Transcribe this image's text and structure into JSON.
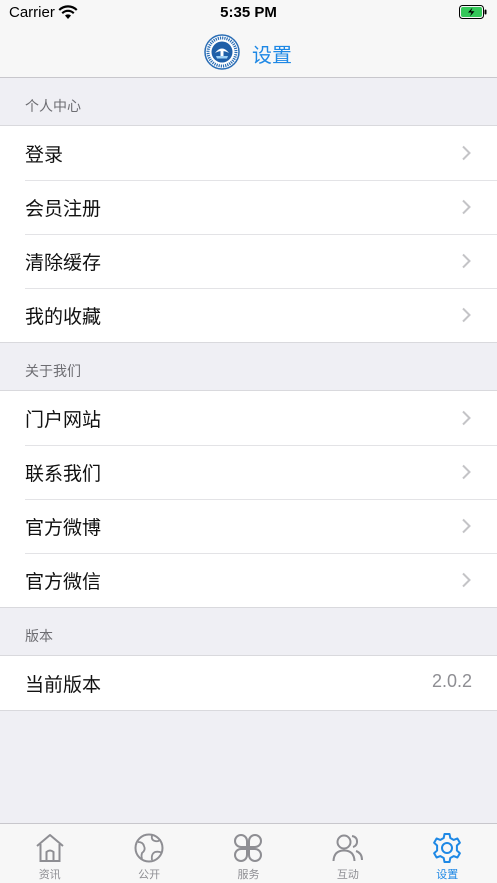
{
  "status_bar": {
    "carrier": "Carrier",
    "time": "5:35 PM"
  },
  "nav": {
    "title": "设置",
    "accent_color": "#1e88e5"
  },
  "sections": [
    {
      "header": "个人中心",
      "rows": [
        {
          "label": "登录"
        },
        {
          "label": "会员注册"
        },
        {
          "label": "清除缓存"
        },
        {
          "label": "我的收藏"
        }
      ]
    },
    {
      "header": "关于我们",
      "rows": [
        {
          "label": "门户网站"
        },
        {
          "label": "联系我们"
        },
        {
          "label": "官方微博"
        },
        {
          "label": "官方微信"
        }
      ]
    },
    {
      "header": "版本",
      "rows": [
        {
          "label": "当前版本",
          "value": "2.0.2"
        }
      ]
    }
  ],
  "tabs": [
    {
      "label": "资讯",
      "icon": "home-icon"
    },
    {
      "label": "公开",
      "icon": "globe-icon"
    },
    {
      "label": "服务",
      "icon": "grid-icon"
    },
    {
      "label": "互动",
      "icon": "users-icon"
    },
    {
      "label": "设置",
      "icon": "gear-icon",
      "active": true
    }
  ]
}
